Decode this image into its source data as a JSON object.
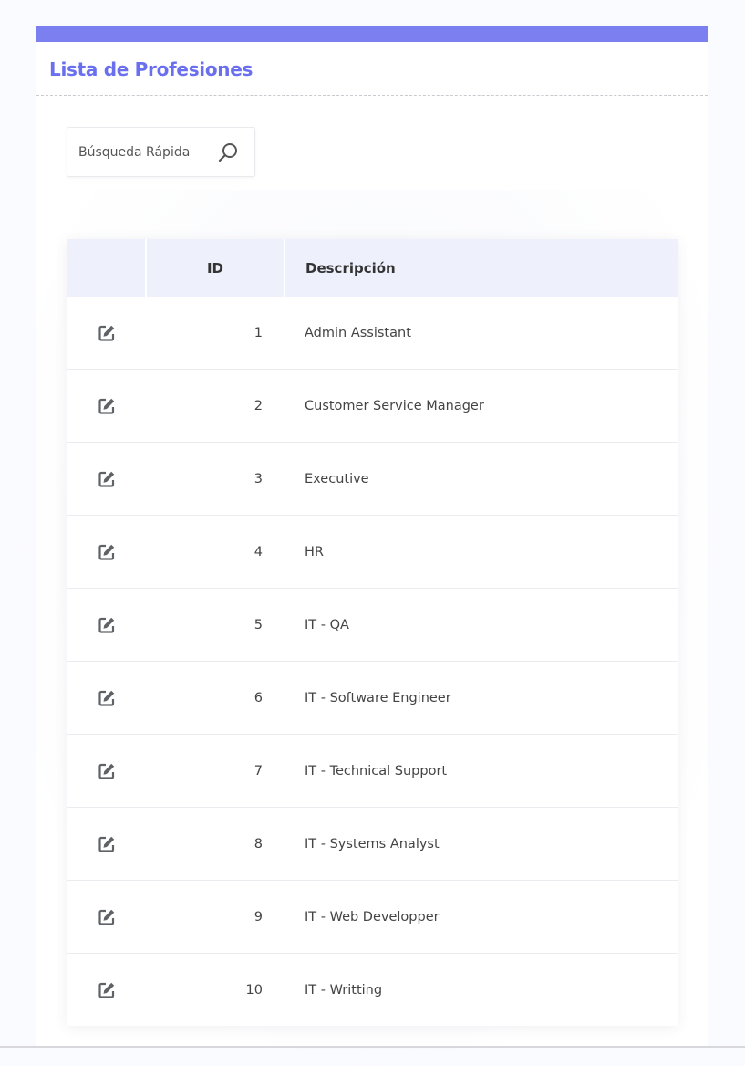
{
  "panel": {
    "title": "Lista de Profesiones",
    "accent_color": "#7b7ff0",
    "title_color": "#6a6ff0"
  },
  "search": {
    "placeholder": "Búsqueda Rápida",
    "value": "",
    "icon": "search-icon"
  },
  "table": {
    "columns": [
      "",
      "ID",
      "Descripción"
    ],
    "row_icon": "edit-icon",
    "rows": [
      {
        "id": "1",
        "description": "Admin Assistant"
      },
      {
        "id": "2",
        "description": "Customer Service Manager"
      },
      {
        "id": "3",
        "description": "Executive"
      },
      {
        "id": "4",
        "description": "HR"
      },
      {
        "id": "5",
        "description": "IT - QA"
      },
      {
        "id": "6",
        "description": "IT - Software Engineer"
      },
      {
        "id": "7",
        "description": "IT - Technical Support"
      },
      {
        "id": "8",
        "description": "IT - Systems Analyst"
      },
      {
        "id": "9",
        "description": "IT - Web Developper"
      },
      {
        "id": "10",
        "description": "IT - Writting"
      }
    ]
  }
}
